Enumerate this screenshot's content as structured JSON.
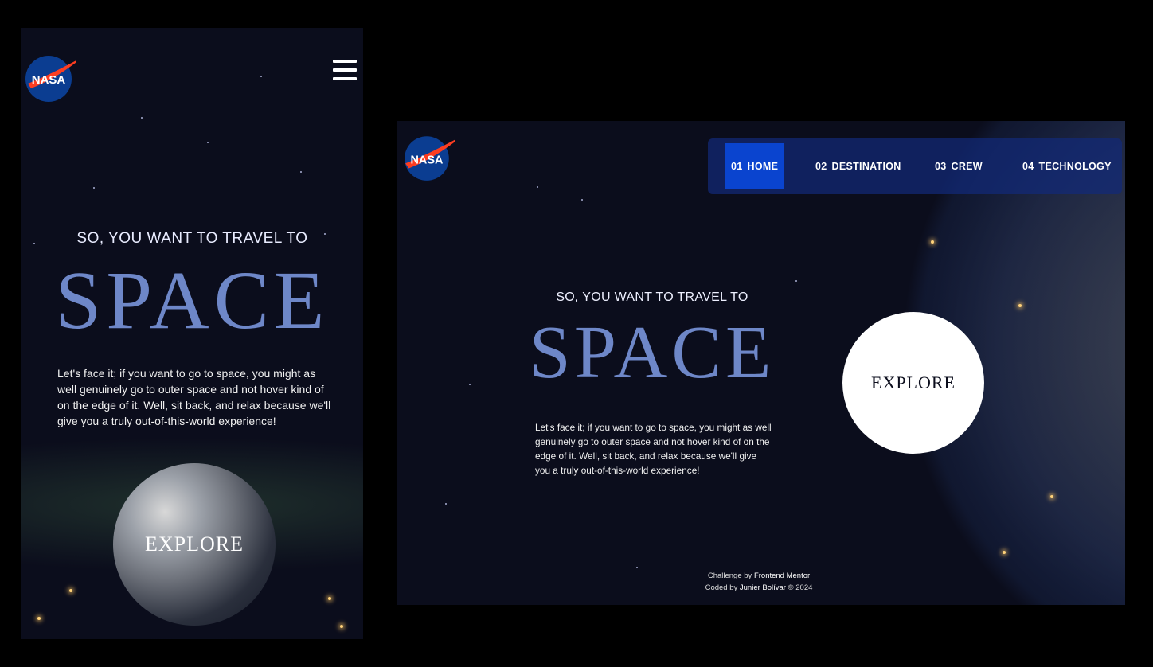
{
  "logo": {
    "text": "NASA"
  },
  "hero": {
    "kicker": "SO, YOU WANT TO TRAVEL TO",
    "title": "SPACE",
    "body": "Let's face it; if you want to go to space, you might as well genuinely go to outer space and not hover kind of on the edge of it. Well, sit back, and relax because we'll give you a truly out-of-this-world experience!",
    "cta": "EXPLORE"
  },
  "nav": {
    "items": [
      {
        "num": "01",
        "label": "HOME",
        "active": true
      },
      {
        "num": "02",
        "label": "DESTINATION",
        "active": false
      },
      {
        "num": "03",
        "label": "CREW",
        "active": false
      },
      {
        "num": "04",
        "label": "TECHNOLOGY",
        "active": false
      }
    ]
  },
  "footer": {
    "line1_prefix": "Challenge by",
    "line1_link": "Frontend Mentor",
    "line2_prefix": "Coded by",
    "line2_link": "Junier Bolívar",
    "line2_suffix": "© 2024"
  },
  "icons": {
    "menu": "hamburger-icon",
    "logo": "nasa-logo"
  },
  "colors": {
    "accent": "#0a44cf",
    "title": "#6e87c8",
    "background": "#0b0d1c"
  }
}
